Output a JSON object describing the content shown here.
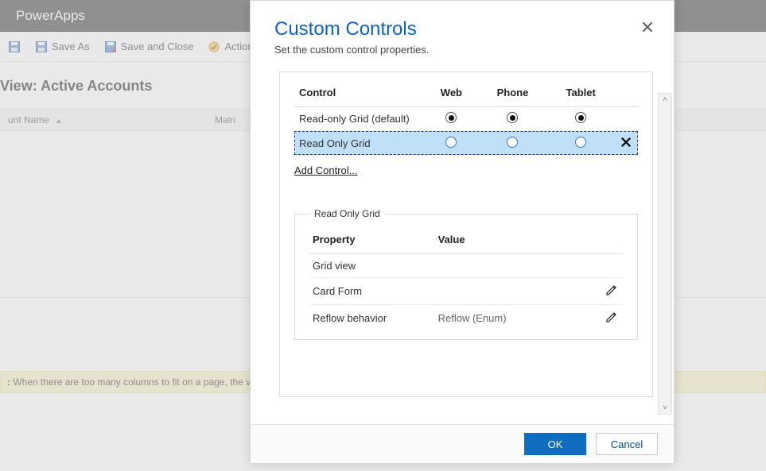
{
  "app": {
    "title": "PowerApps",
    "toolbar": {
      "save_as": "Save As",
      "save_close": "Save and Close",
      "actions": "Actions"
    },
    "view": {
      "title": "View: Active Accounts",
      "columns": {
        "c0": "unt Name",
        "c1": "Main"
      },
      "note_label": ":",
      "note_text": " When there are too many columns to fit on a page, the view "
    }
  },
  "dialog": {
    "title": "Custom Controls",
    "subtitle": "Set the custom control properties.",
    "headers": {
      "control": "Control",
      "web": "Web",
      "phone": "Phone",
      "tablet": "Tablet"
    },
    "rows": {
      "default": {
        "label": "Read-only Grid (default)",
        "web": true,
        "phone": true,
        "tablet": true
      },
      "selected": {
        "label": "Read Only Grid",
        "web": false,
        "phone": false,
        "tablet": false
      }
    },
    "add_control": "Add Control...",
    "propset": {
      "legend": "Read Only Grid",
      "headers": {
        "property": "Property",
        "value": "Value"
      },
      "rows": {
        "r0": {
          "property": "Grid view",
          "value": ""
        },
        "r1": {
          "property": "Card Form",
          "value": ""
        },
        "r2": {
          "property": "Reflow behavior",
          "value": "Reflow (Enum)"
        }
      }
    },
    "buttons": {
      "ok": "OK",
      "cancel": "Cancel"
    }
  }
}
